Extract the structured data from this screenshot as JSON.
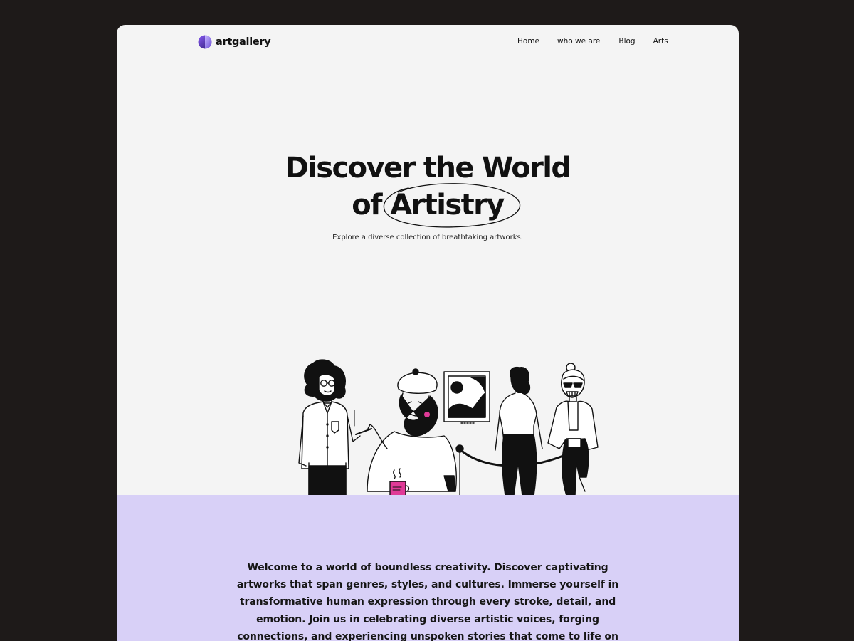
{
  "brand": {
    "name": "artgallery",
    "icon": "gradient-circle-logo-icon",
    "gradient_colors": [
      "#8a5cf6",
      "#2a1a6e"
    ]
  },
  "nav": {
    "items": [
      {
        "label": "Home"
      },
      {
        "label": "who we are"
      },
      {
        "label": "Blog"
      },
      {
        "label": "Arts"
      }
    ]
  },
  "hero": {
    "title_line1": "Discover the World",
    "title_line2_prefix": "of",
    "title_highlight": "Artistry",
    "subtitle": "Explore a diverse collection of breathtaking artworks."
  },
  "illustration": {
    "name": "gallery-visitors-illustration",
    "accent_color": "#e03a97"
  },
  "about": {
    "background_color": "#d8d0f7",
    "text": "Welcome to a world of boundless creativity. Discover captivating artworks that span genres, styles, and cultures. Immerse yourself in transformative human expression through every stroke, detail, and emotion. Join us in celebrating diverse artistic voices, forging connections, and experiencing unspoken stories that come to life on canvas, screen, and sculpture. Let the"
  }
}
